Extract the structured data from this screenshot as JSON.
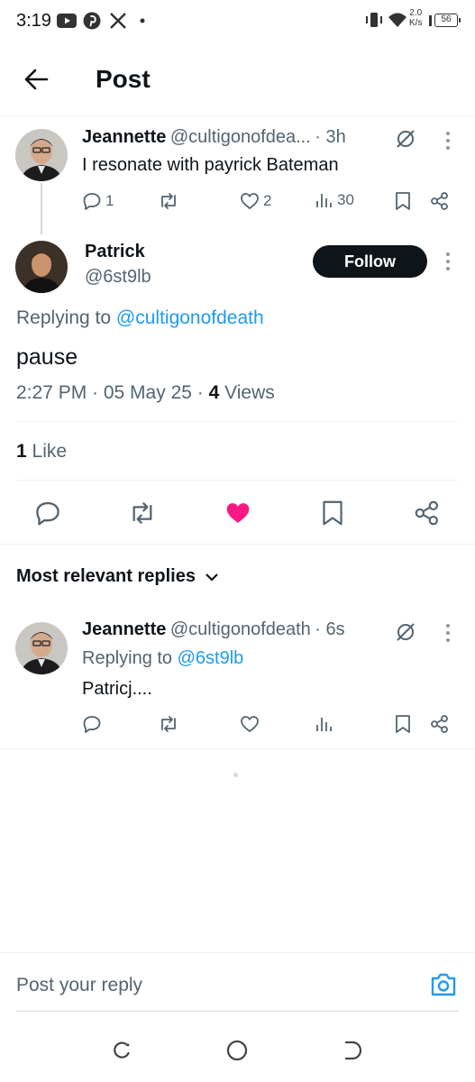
{
  "status_bar": {
    "time": "3:19",
    "net_speed_value": "2.0",
    "net_speed_unit": "K/s",
    "battery": "56",
    "icons": [
      "youtube-icon",
      "pinterest-icon",
      "x-icon",
      "dot-icon",
      "vibrate-icon",
      "wifi-icon",
      "signal-icon",
      "battery-icon"
    ]
  },
  "header": {
    "title": "Post"
  },
  "parent_post": {
    "name": "Jeannette",
    "handle": "@cultigonofdea...",
    "time": "· 3h",
    "text": "I resonate with payrick Bateman",
    "replies": "1",
    "likes": "2",
    "views": "30"
  },
  "main_post": {
    "name": "Patrick",
    "handle": "@6st9lb",
    "follow_label": "Follow",
    "replying_prefix": "Replying to",
    "replying_handle": "@cultigonofdeath",
    "text": "pause",
    "timestamp": "2:27 PM · 05 May 25 · ",
    "views_count": "4",
    "views_label": " Views",
    "likes_count": "1",
    "likes_label": " Like",
    "liked": true
  },
  "replies_section": {
    "sort_label": "Most relevant replies"
  },
  "reply": {
    "name": "Jeannette",
    "handle": "@cultigonofdeath",
    "time": "· 6s",
    "replying_prefix": "Replying to",
    "replying_handle": "@6st9lb",
    "text": "Patricj...."
  },
  "compose": {
    "placeholder": "Post your reply"
  },
  "colors": {
    "accent": "#1d9bf0",
    "like": "#f91880",
    "text": "#0f1419",
    "muted": "#536471"
  }
}
